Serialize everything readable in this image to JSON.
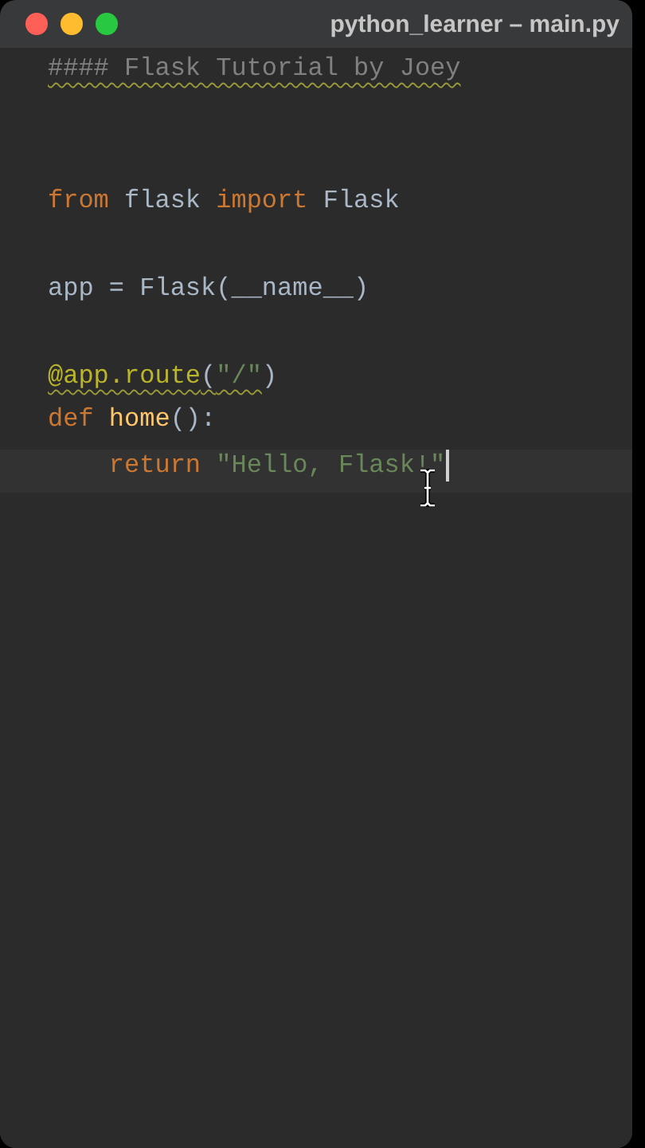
{
  "window": {
    "title": "python_learner – main.py"
  },
  "editor": {
    "lines": [
      {
        "current": false,
        "tokens": [
          {
            "text": "#### Flask Tutorial by Joey",
            "kind": "comment",
            "warning": true
          }
        ]
      },
      {
        "current": false
      },
      {
        "current": false
      },
      {
        "current": false,
        "tokens": [
          {
            "text": "from",
            "kind": "keyword",
            "warning": false
          },
          {
            "text": " flask ",
            "kind": "plain",
            "warning": false
          },
          {
            "text": "import",
            "kind": "keyword",
            "warning": false
          },
          {
            "text": " Flask",
            "kind": "plain",
            "warning": false
          }
        ]
      },
      {
        "current": false
      },
      {
        "current": false,
        "tokens": [
          {
            "text": "app = Flask(__name__)",
            "kind": "plain",
            "warning": false
          }
        ]
      },
      {
        "current": false
      },
      {
        "current": false,
        "tokens": [
          {
            "text": "@app.route",
            "kind": "decorator",
            "warning": true
          },
          {
            "text": "(",
            "kind": "plain",
            "warning": true
          },
          {
            "text": "\"/\"",
            "kind": "string",
            "warning": true
          },
          {
            "text": ")",
            "kind": "plain",
            "warning": false
          }
        ]
      },
      {
        "current": false,
        "tokens": [
          {
            "text": "def ",
            "kind": "keyword",
            "warning": false
          },
          {
            "text": "home",
            "kind": "function",
            "warning": false
          },
          {
            "text": "():",
            "kind": "plain",
            "warning": false
          }
        ]
      },
      {
        "current": true,
        "tokens": [
          {
            "text": "    return ",
            "kind": "keyword",
            "warning": false
          },
          {
            "text": "\"Hello, Flask!\"",
            "kind": "string",
            "warning": false
          }
        ]
      }
    ]
  }
}
